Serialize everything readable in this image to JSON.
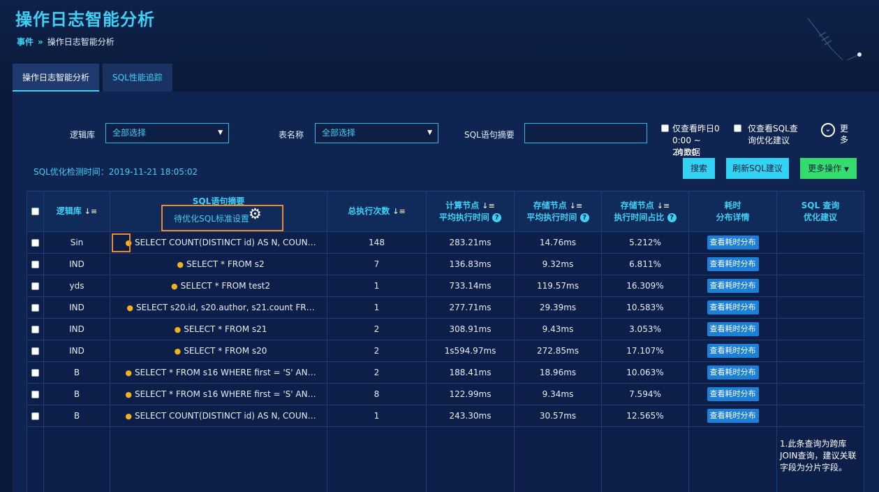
{
  "page": {
    "title": "操作日志智能分析",
    "breadcrumb": {
      "root": "事件",
      "separator": "»",
      "current": "操作日志智能分析"
    }
  },
  "tabs": [
    {
      "label": "操作日志智能分析",
      "active": true
    },
    {
      "label": "SQL性能追踪",
      "active": false
    }
  ],
  "filters": {
    "db_label": "逻辑库",
    "db_value": "全部选择",
    "table_label": "表名称",
    "table_value": "全部选择",
    "sql_label": "SQL语句摘要",
    "sql_value": "",
    "yesterday_option": [
      "仅查看昨日0",
      "0:00 ~ 24:00",
      "的数据"
    ],
    "advice_option": [
      "仅查看SQL查",
      "询优化建议"
    ],
    "more_label": "更多"
  },
  "detect_time": "SQL优化检测时间：2019-11-21 18:05:02",
  "buttons": {
    "search": "搜索",
    "refresh": "刷新SQL建议",
    "more_ops": "更多操作"
  },
  "table": {
    "headers": {
      "db": "逻辑库",
      "sql": "SQL语句摘要",
      "sql_setting": "待优化SQL标准设置",
      "count": "总执行次数",
      "compute": "计算节点",
      "compute_sub": "平均执行时间",
      "storage": "存储节点",
      "storage_sub": "平均执行时间",
      "storage_ratio": "存储节点",
      "storage_ratio_sub": "执行时间占比",
      "dist": "耗时",
      "dist_sub": "分布详情",
      "advice": "SQL 查询",
      "advice_sub": "优化建议"
    },
    "dist_button": "查看耗时分布",
    "rows": [
      {
        "db": "Sin",
        "sql": "SELECT COUNT(DISTINCT id) AS N, COUN…",
        "count": "148",
        "compute": "283.21ms",
        "storage": "14.76ms",
        "ratio": "5.212%"
      },
      {
        "db": "IND",
        "sql": "SELECT * FROM s2",
        "count": "7",
        "compute": "136.83ms",
        "storage": "9.32ms",
        "ratio": "6.811%"
      },
      {
        "db": "yds",
        "sql": "SELECT * FROM test2",
        "count": "1",
        "compute": "733.14ms",
        "storage": "119.57ms",
        "ratio": "16.309%"
      },
      {
        "db": "IND",
        "sql": "SELECT s20.id, s20.author, s21.count FR…",
        "count": "1",
        "compute": "277.71ms",
        "storage": "29.39ms",
        "ratio": "10.583%"
      },
      {
        "db": "IND",
        "sql": "SELECT * FROM s21",
        "count": "2",
        "compute": "308.91ms",
        "storage": "9.43ms",
        "ratio": "3.053%"
      },
      {
        "db": "IND",
        "sql": "SELECT * FROM s20",
        "count": "2",
        "compute": "1s594.97ms",
        "storage": "272.85ms",
        "ratio": "17.107%"
      },
      {
        "db": "B",
        "sql": "SELECT * FROM s16 WHERE first = 'S' AN…",
        "count": "2",
        "compute": "188.41ms",
        "storage": "18.96ms",
        "ratio": "10.063%"
      },
      {
        "db": "B",
        "sql": "SELECT * FROM s16 WHERE first = 'S' AN…",
        "count": "8",
        "compute": "122.99ms",
        "storage": "9.34ms",
        "ratio": "7.594%"
      },
      {
        "db": "B",
        "sql": "SELECT COUNT(DISTINCT id) AS N, COUN…",
        "count": "1",
        "compute": "243.30ms",
        "storage": "30.57ms",
        "ratio": "12.565%"
      }
    ],
    "advice_text": "1.此条查询为跨库JOIN查询，建议关联字段为分片字段。"
  }
}
